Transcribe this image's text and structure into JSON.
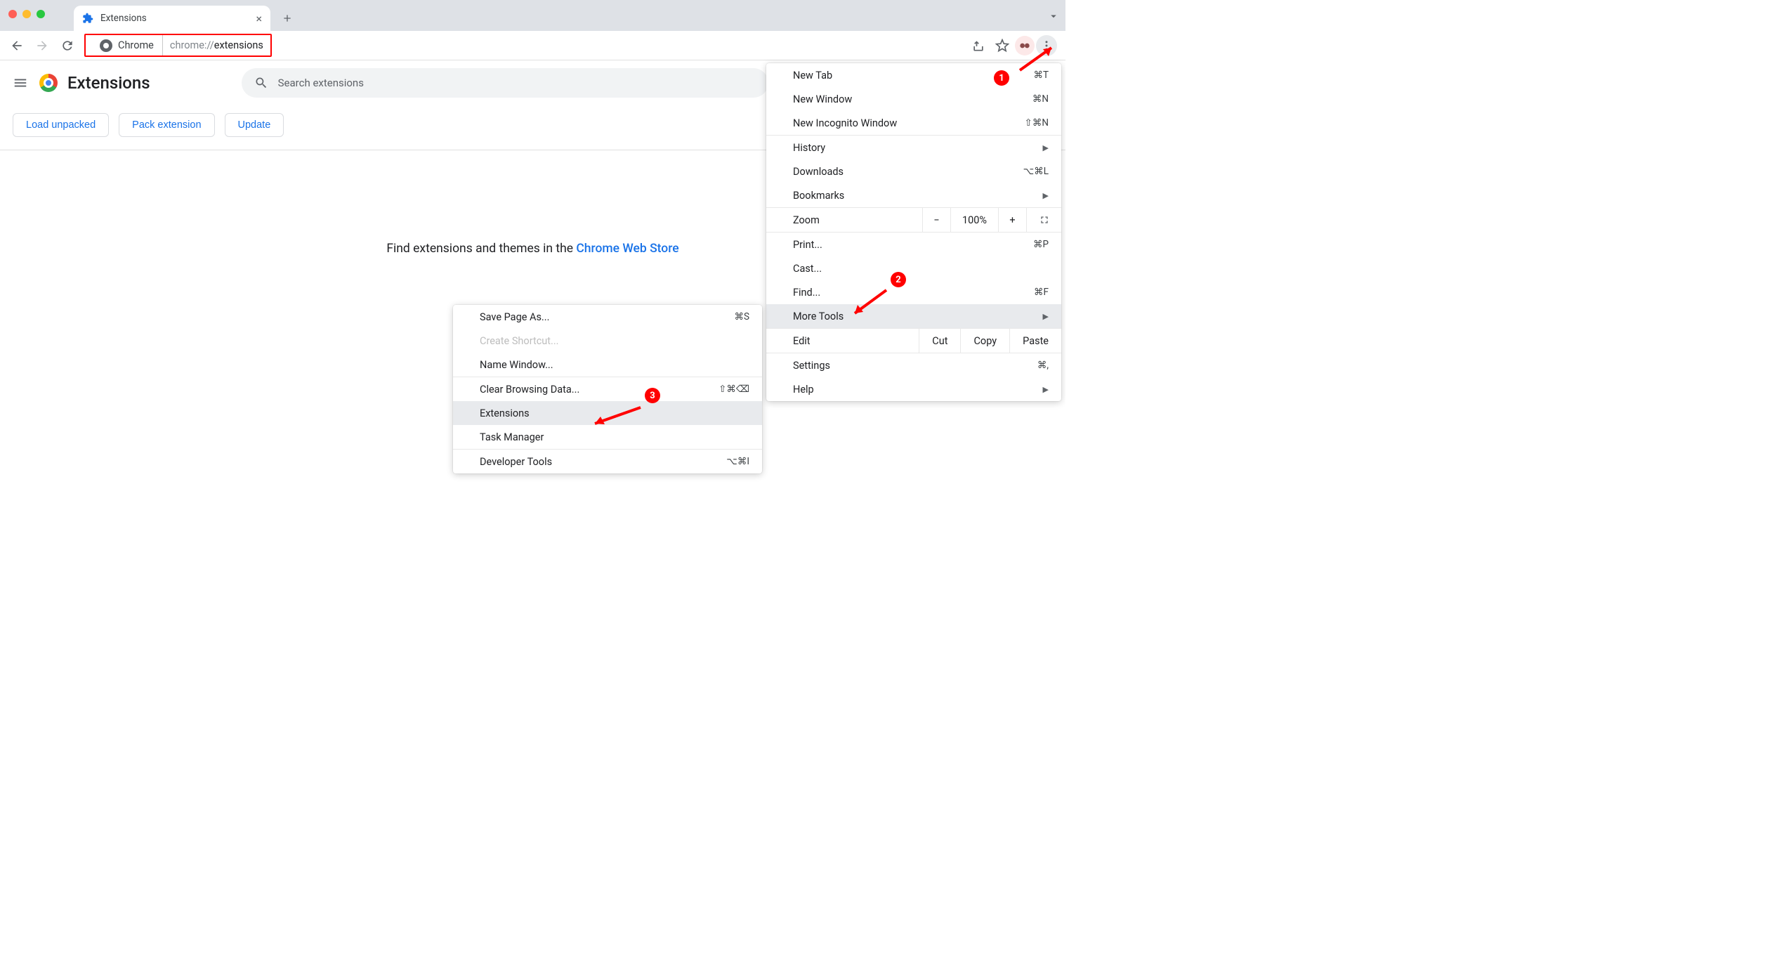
{
  "tab": {
    "title": "Extensions"
  },
  "omnibox": {
    "chip": "Chrome",
    "prefix": "chrome://",
    "path": "extensions"
  },
  "page": {
    "title": "Extensions",
    "search_placeholder": "Search extensions",
    "actions": {
      "load_unpacked": "Load unpacked",
      "pack_extension": "Pack extension",
      "update": "Update"
    },
    "body_prefix": "Find extensions and themes in the ",
    "body_link": "Chrome Web Store"
  },
  "main_menu": {
    "new_tab": {
      "label": "New Tab",
      "shortcut": "⌘T"
    },
    "new_window": {
      "label": "New Window",
      "shortcut": "⌘N"
    },
    "new_incognito": {
      "label": "New Incognito Window",
      "shortcut": "⇧⌘N"
    },
    "history": {
      "label": "History"
    },
    "downloads": {
      "label": "Downloads",
      "shortcut": "⌥⌘L"
    },
    "bookmarks": {
      "label": "Bookmarks"
    },
    "zoom": {
      "label": "Zoom",
      "value": "100%"
    },
    "print": {
      "label": "Print...",
      "shortcut": "⌘P"
    },
    "cast": {
      "label": "Cast..."
    },
    "find": {
      "label": "Find...",
      "shortcut": "⌘F"
    },
    "more_tools": {
      "label": "More Tools"
    },
    "edit": {
      "label": "Edit",
      "cut": "Cut",
      "copy": "Copy",
      "paste": "Paste"
    },
    "settings": {
      "label": "Settings",
      "shortcut": "⌘,"
    },
    "help": {
      "label": "Help"
    }
  },
  "sub_menu": {
    "save_page": {
      "label": "Save Page As...",
      "shortcut": "⌘S"
    },
    "create_shortcut": {
      "label": "Create Shortcut..."
    },
    "name_window": {
      "label": "Name Window..."
    },
    "clear_browsing": {
      "label": "Clear Browsing Data...",
      "shortcut": "⇧⌘⌫"
    },
    "extensions": {
      "label": "Extensions"
    },
    "task_manager": {
      "label": "Task Manager"
    },
    "dev_tools": {
      "label": "Developer Tools",
      "shortcut": "⌥⌘I"
    }
  },
  "annotations": {
    "b1": "1",
    "b2": "2",
    "b3": "3"
  }
}
